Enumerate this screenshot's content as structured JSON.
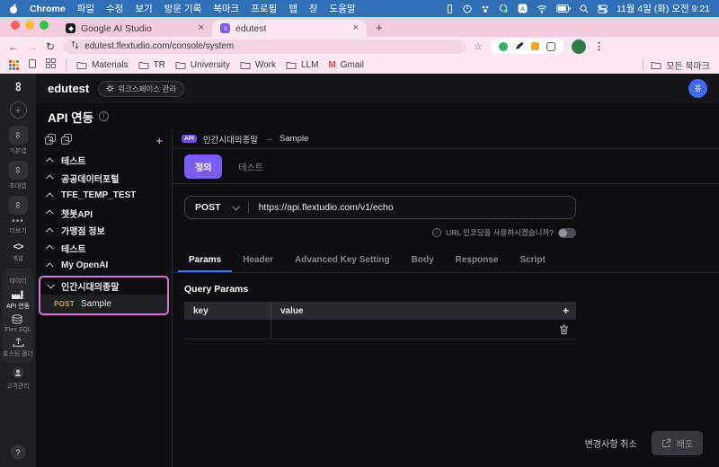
{
  "menu_bar": {
    "app_name": "Chrome",
    "items": [
      "파일",
      "수정",
      "보기",
      "방문 기록",
      "북마크",
      "프로필",
      "탭",
      "창",
      "도움말"
    ],
    "status_icons": [
      "display-icon",
      "timer-icon",
      "keystroke-icon",
      "shield-check-icon",
      "input-source-icon",
      "wifi-icon",
      "battery-icon",
      "search-icon",
      "control-center-icon"
    ],
    "clock": "11월 4일 (화) 오전 9:21"
  },
  "browser": {
    "tabs": [
      {
        "label": "Google AI Studio",
        "active": false
      },
      {
        "label": "edutest",
        "active": true
      }
    ],
    "url": "edutest.flextudio.com/console/system",
    "bookmarks": {
      "folders": [
        "Materials",
        "TR",
        "University",
        "Work",
        "LLM"
      ],
      "gmail": "Gmail",
      "all_bookmarks": "모든 북마크"
    }
  },
  "rail": {
    "apps": [
      {
        "label": "기본앱"
      },
      {
        "label": "초대앱"
      },
      {
        "label": ""
      }
    ],
    "more_label": "더보기",
    "dev_label": "개발",
    "code_glyph": "<>",
    "data_label": "데이터",
    "api_label": "API 연동",
    "flexsql_label": "Flex SQL",
    "hosting_label": "호스팅 폴더",
    "customer_label": "고객관리",
    "help_label": "?"
  },
  "workspace": {
    "name": "edutest",
    "manage_button": "워크스페이스 관리",
    "page_title": "API 연동"
  },
  "tree": {
    "groups": [
      "테스트",
      "공공데이터포털",
      "TFE_TEMP_TEST",
      "챗봇API",
      "가맹점 정보",
      "테스트",
      "My OpenAI"
    ],
    "expanded_group": "인간시대의종말",
    "child": {
      "method": "POST",
      "name": "Sample"
    }
  },
  "editor": {
    "breadcrumb": {
      "badge": "API",
      "group": "인간시대의종말",
      "arrow": "→",
      "item": "Sample"
    },
    "mode_tabs": {
      "define": "정의",
      "test": "테스트"
    },
    "request": {
      "method": "POST",
      "url": "https://api.flextudio.com/v1/echo"
    },
    "encoding_question": "URL 인코딩을 사용하시겠습니까?",
    "tabs": [
      "Params",
      "Header",
      "Advanced Key Setting",
      "Body",
      "Response",
      "Script"
    ],
    "active_tab": "Params",
    "section_title": "Query Params",
    "table_headers": {
      "key": "key",
      "value": "value"
    },
    "footer": {
      "cancel": "변경사항 취소",
      "deploy": "배포"
    }
  },
  "colors": {
    "accent_purple": "#7c5cf6",
    "highlight_pink": "#dd6fd2",
    "method_amber": "#cfa43c",
    "tab_underline_blue": "#4b74f0",
    "menubar_blue": "#2f6fb7",
    "chrome_pink": "#fde7f2"
  }
}
